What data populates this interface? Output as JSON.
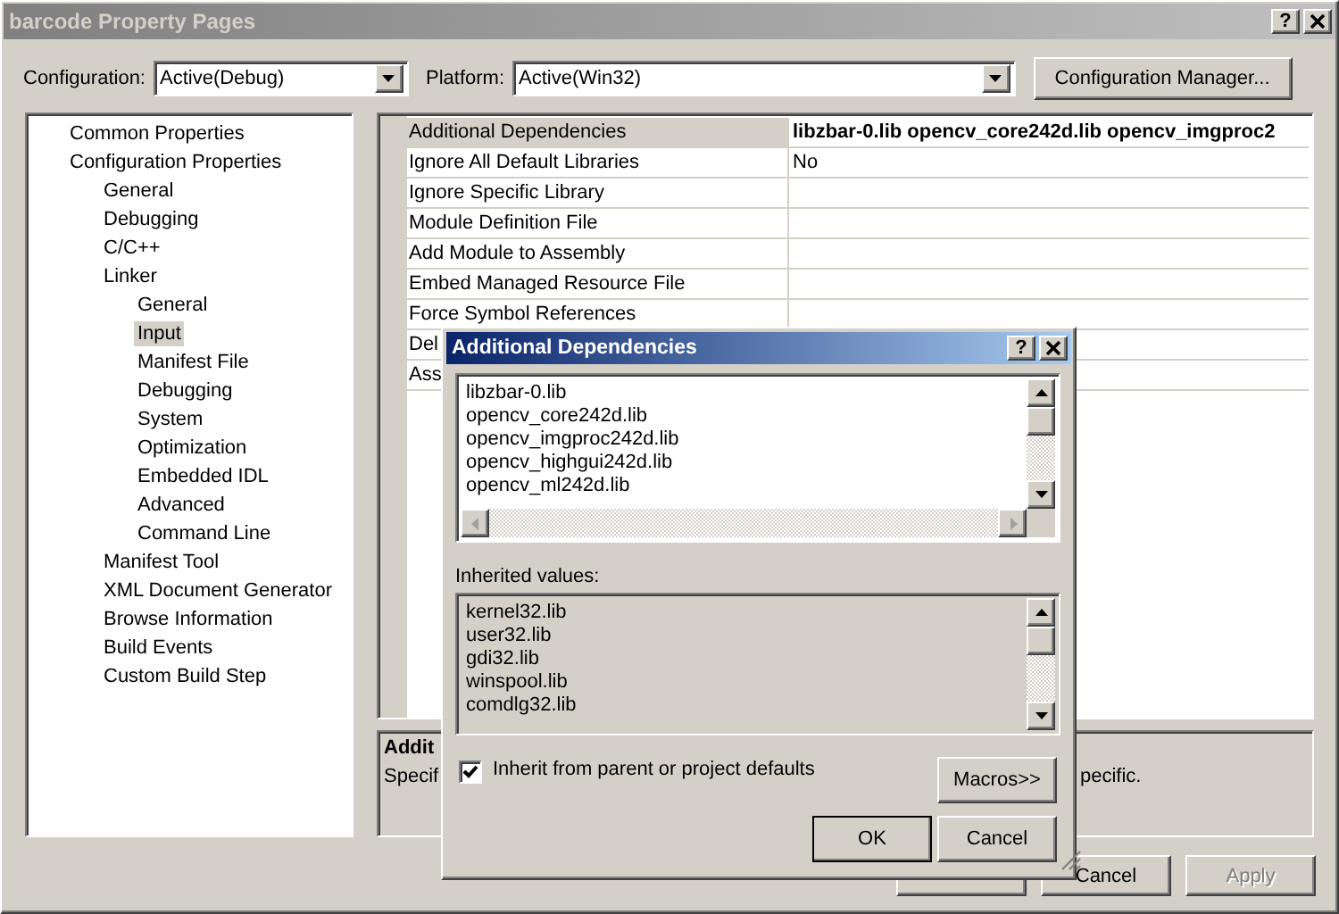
{
  "window": {
    "title": "barcode Property Pages",
    "help": "?"
  },
  "toolbar": {
    "configuration": {
      "label": "Configuration:",
      "value": "Active(Debug)"
    },
    "platform": {
      "label": "Platform:",
      "value": "Active(Win32)"
    },
    "manager_button": "Configuration Manager..."
  },
  "tree": [
    {
      "label": "Common Properties",
      "selected": false
    },
    {
      "label": "Configuration Properties",
      "selected": false,
      "children": [
        {
          "label": "General",
          "selected": false
        },
        {
          "label": "Debugging",
          "selected": false
        },
        {
          "label": "C/C++",
          "selected": false
        },
        {
          "label": "Linker",
          "selected": false,
          "children": [
            {
              "label": "General",
              "selected": false
            },
            {
              "label": "Input",
              "selected": true
            },
            {
              "label": "Manifest File",
              "selected": false
            },
            {
              "label": "Debugging",
              "selected": false
            },
            {
              "label": "System",
              "selected": false
            },
            {
              "label": "Optimization",
              "selected": false
            },
            {
              "label": "Embedded IDL",
              "selected": false
            },
            {
              "label": "Advanced",
              "selected": false
            },
            {
              "label": "Command Line",
              "selected": false
            }
          ]
        },
        {
          "label": "Manifest Tool",
          "selected": false
        },
        {
          "label": "XML Document Generator",
          "selected": false
        },
        {
          "label": "Browse Information",
          "selected": false
        },
        {
          "label": "Build Events",
          "selected": false
        },
        {
          "label": "Custom Build Step",
          "selected": false
        }
      ]
    }
  ],
  "grid": [
    {
      "name": "Additional Dependencies",
      "value": "libzbar-0.lib opencv_core242d.lib opencv_imgproc2",
      "selected": true
    },
    {
      "name": "Ignore All Default Libraries",
      "value": "No",
      "selected": false
    },
    {
      "name": "Ignore Specific Library",
      "selected": false
    },
    {
      "name": "Module Definition File",
      "selected": false
    },
    {
      "name": "Add Module to Assembly",
      "selected": false
    },
    {
      "name": "Embed Managed Resource File",
      "selected": false
    },
    {
      "name": "Force Symbol References",
      "selected": false
    },
    {
      "name": "Del",
      "selected": false
    },
    {
      "name": "Ass",
      "selected": false
    }
  ],
  "description": {
    "title": "Addit",
    "text_left": "Specif",
    "text_right": "pecific."
  },
  "buttons": [
    {
      "label": "Cancel",
      "disabled": false
    },
    {
      "label": "Apply",
      "disabled": true
    }
  ],
  "dialog": {
    "title": "Additional Dependencies",
    "help": "?",
    "values": [
      "libzbar-0.lib",
      "opencv_core242d.lib",
      "opencv_imgproc242d.lib",
      "opencv_highgui242d.lib",
      "opencv_ml242d.lib"
    ],
    "inherited_label": "Inherited values:",
    "inherited": [
      "kernel32.lib",
      "user32.lib",
      "gdi32.lib",
      "winspool.lib",
      "comdlg32.lib"
    ],
    "inherit_checkbox": {
      "label": "Inherit from parent or project defaults",
      "checked": true
    },
    "macros_button": "Macros>>",
    "ok_button": "OK",
    "cancel_button": "Cancel"
  }
}
